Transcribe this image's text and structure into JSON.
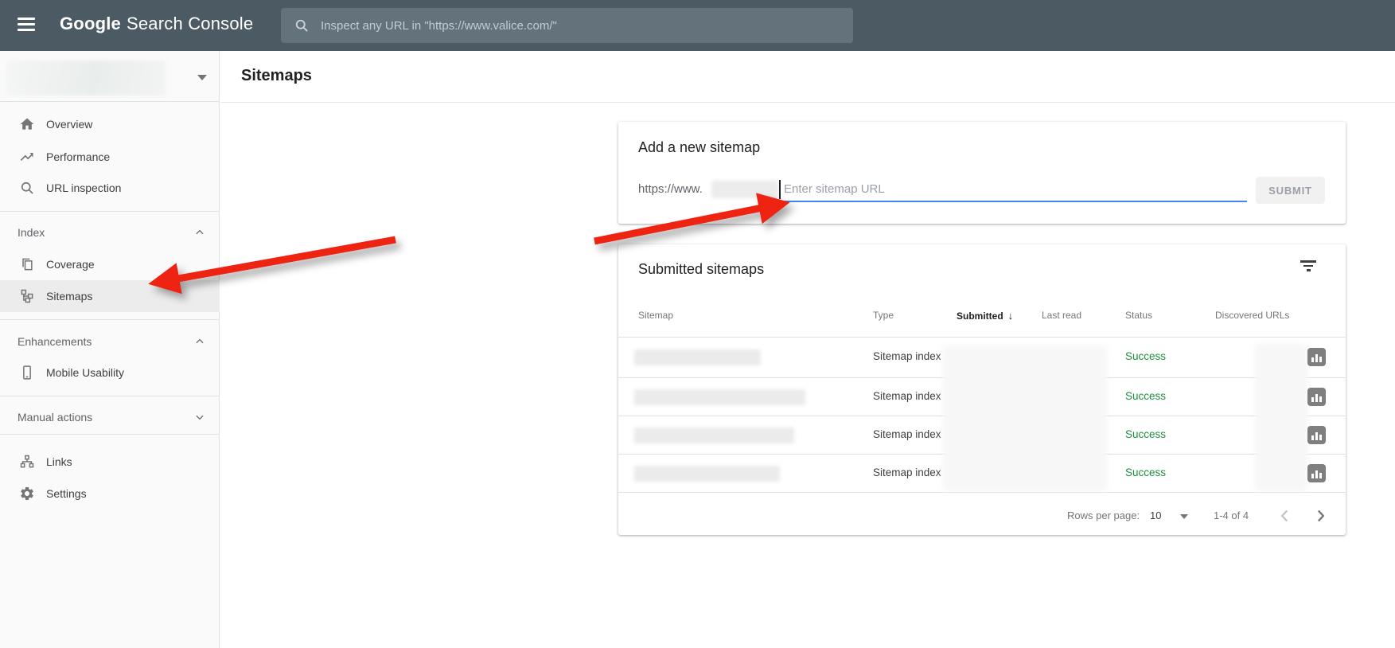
{
  "colors": {
    "topbar": "#4c5a64",
    "accent_blue": "#4285f4",
    "success_green": "#1e8e3e",
    "arrow_red": "#ee2312"
  },
  "topbar": {
    "logo_part1": "Google",
    "logo_part2": "Search Console",
    "search_placeholder": "Inspect any URL in \"https://www.valice.com/\""
  },
  "sidebar": {
    "overview": "Overview",
    "performance": "Performance",
    "url_inspection": "URL inspection",
    "index_section": "Index",
    "coverage": "Coverage",
    "sitemaps": "Sitemaps",
    "enhancements_section": "Enhancements",
    "mobile_usability": "Mobile Usability",
    "manual_actions_section": "Manual actions",
    "links": "Links",
    "settings": "Settings"
  },
  "page": {
    "title": "Sitemaps"
  },
  "add_sitemap": {
    "title": "Add a new sitemap",
    "url_prefix": "https://www.",
    "input_placeholder": "Enter sitemap URL",
    "submit_label": "SUBMIT"
  },
  "submitted": {
    "title": "Submitted sitemaps",
    "columns": {
      "sitemap": "Sitemap",
      "type": "Type",
      "submitted": "Submitted",
      "last_read": "Last read",
      "status": "Status",
      "discovered": "Discovered URLs"
    },
    "sort_icon": "↓",
    "rows": [
      {
        "type": "Sitemap index",
        "status": "Success"
      },
      {
        "type": "Sitemap index",
        "status": "Success"
      },
      {
        "type": "Sitemap index",
        "status": "Success"
      },
      {
        "type": "Sitemap index",
        "status": "Success"
      }
    ],
    "pagination": {
      "rows_per_page_label": "Rows per page:",
      "rows_per_page_value": "10",
      "range": "1-4 of 4"
    }
  }
}
